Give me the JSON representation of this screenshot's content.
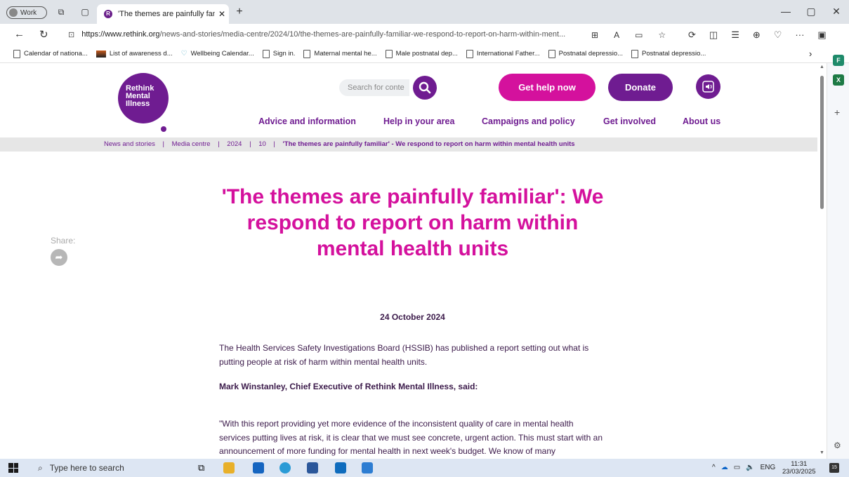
{
  "browser": {
    "profile_label": "Work",
    "tab_title": "'The themes are painfully familiar'",
    "tab_favicon_letter": "R",
    "new_tab_symbol": "+",
    "url_domain": "https://www.rethink.org",
    "url_path": "/news-and-stories/media-centre/2024/10/the-themes-are-painfully-familiar-we-respond-to-report-on-harm-within-ment...",
    "more_menu": "···"
  },
  "bookmarks": [
    {
      "label": "Calendar of nationa...",
      "icon": "page-icon"
    },
    {
      "label": "List of awareness d...",
      "icon": "image-icon"
    },
    {
      "label": "Wellbeing Calendar...",
      "icon": "heart-icon"
    },
    {
      "label": "Sign in.",
      "icon": "page-icon"
    },
    {
      "label": "Maternal mental he...",
      "icon": "page-icon"
    },
    {
      "label": "Male postnatal dep...",
      "icon": "page-icon"
    },
    {
      "label": "International Father...",
      "icon": "page-icon"
    },
    {
      "label": "Postnatal depressio...",
      "icon": "page-icon"
    },
    {
      "label": "Postnatal depressio...",
      "icon": "page-icon"
    }
  ],
  "site": {
    "logo_lines": [
      "Rethink",
      "Mental",
      "Illness"
    ],
    "search_placeholder": "Search for conte",
    "help_button": "Get help now",
    "donate_button": "Donate",
    "nav": [
      "Advice and information",
      "Help in your area",
      "Campaigns and policy",
      "Get involved",
      "About us"
    ],
    "breadcrumbs": [
      "News and stories",
      "Media centre",
      "2024",
      "10"
    ],
    "breadcrumb_current": "'The themes are painfully familiar' - We respond to report on harm within mental health units",
    "breadcrumb_separator": "|",
    "colors": {
      "purple": "#6f1c91",
      "magenta": "#d4119d"
    }
  },
  "article": {
    "share_label": "Share:",
    "title": "'The themes are painfully familiar': We respond to report on harm within mental health units",
    "date": "24 October 2024",
    "para1": "The Health Services Safety Investigations Board (HSSIB) has published a report setting out what is putting people at risk of harm within mental health units.",
    "para2": "Mark Winstanley, Chief Executive of Rethink Mental Illness, said:",
    "para3": "\"With this report providing yet more evidence of the inconsistent quality of care in mental health services putting lives at risk, it is clear that we must see concrete, urgent action. This must start with an announcement of more funding for mental health in next week's budget. We know of many"
  },
  "taskbar": {
    "search_placeholder": "Type here to search",
    "language": "ENG",
    "time": "11:31",
    "date": "23/03/2025",
    "notification_count": "15"
  }
}
